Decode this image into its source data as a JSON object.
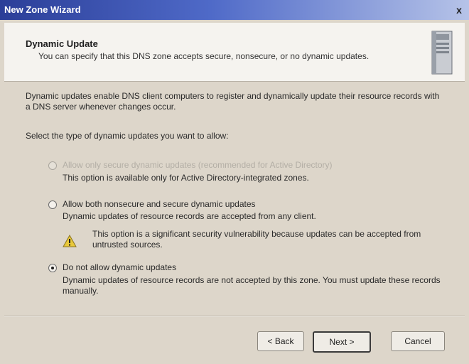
{
  "window": {
    "title": "New Zone Wizard",
    "close_glyph": "x"
  },
  "header": {
    "title": "Dynamic Update",
    "subtitle": "You can specify that this DNS zone accepts secure, nonsecure, or no dynamic updates.",
    "icon": "server-icon"
  },
  "body": {
    "intro": "Dynamic updates enable DNS client computers to register and dynamically update their resource records with a DNS server whenever changes occur.",
    "prompt": "Select the type of dynamic updates you want to allow:",
    "options": [
      {
        "label": "Allow only secure dynamic updates (recommended for Active Directory)",
        "description": "This option is available only for Active Directory-integrated zones.",
        "selected": false,
        "enabled": false
      },
      {
        "label": "Allow both nonsecure and secure dynamic updates",
        "description": "Dynamic updates of resource records are accepted from any client.",
        "warning": "This option is a significant security vulnerability because updates can be accepted from untrusted sources.",
        "selected": false,
        "enabled": true
      },
      {
        "label": "Do not allow dynamic updates",
        "description": "Dynamic updates of resource records are not accepted by this zone. You must update these records manually.",
        "selected": true,
        "enabled": true
      }
    ]
  },
  "buttons": {
    "back": "< Back",
    "next": "Next >",
    "cancel": "Cancel"
  },
  "colors": {
    "titlebar": "#2b3e98",
    "dialog": "#ddd6ca",
    "header": "#f5f3ef",
    "warning": "#e8c83a"
  }
}
